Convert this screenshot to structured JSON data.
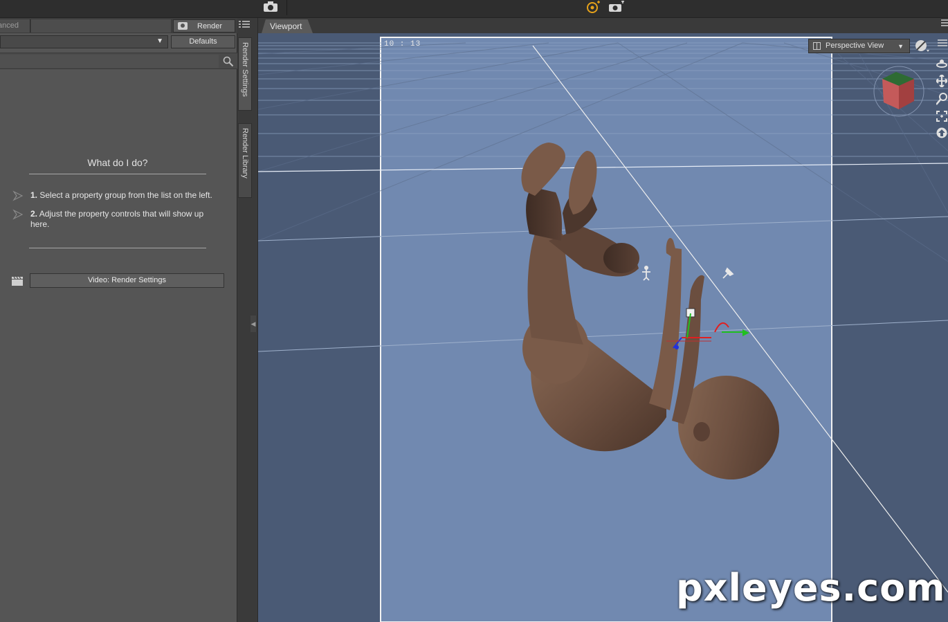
{
  "toolbar": {
    "icons": [
      "camera-icon",
      "render-icon-active",
      "camera-render-icon"
    ]
  },
  "left_panel": {
    "tab_advanced": "anced",
    "render_button": "Render",
    "defaults_button": "Defaults",
    "preset_value": "",
    "search_placeholder": "",
    "help": {
      "title": "What do I do?",
      "steps": [
        {
          "num": "1.",
          "text": " Select a property group from the list on the left."
        },
        {
          "num": "2.",
          "text": " Adjust the property controls that will show up here."
        }
      ]
    },
    "video_button": "Video: Render Settings"
  },
  "side_tabs": {
    "render_settings": "Render Settings",
    "render_library": "Render Library"
  },
  "viewport": {
    "tab": "Viewport",
    "timecode": "10 : 13",
    "view_mode": "Perspective View",
    "watermark": "pxleyes.com"
  },
  "colors": {
    "panel_bg": "#555555",
    "viewport_outer": "#4a5a75",
    "viewport_frame": "#7189b0",
    "accent_orange": "#e6a21a"
  }
}
